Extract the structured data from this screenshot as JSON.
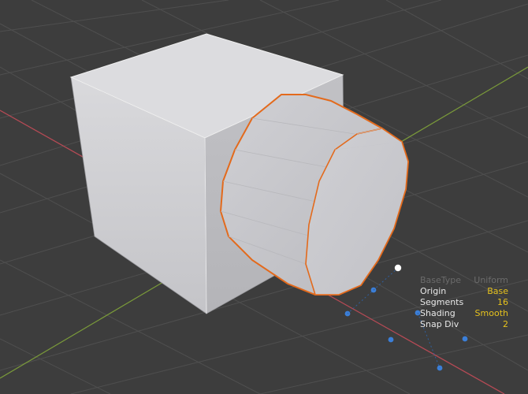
{
  "hud": {
    "rows": [
      {
        "label": "BaseType",
        "value": "Uniform",
        "dim": true
      },
      {
        "label": "Origin",
        "value": "Base"
      },
      {
        "label": "Segments",
        "value": "16"
      },
      {
        "label": "Shading",
        "value": "Smooth"
      },
      {
        "label": "Snap Div",
        "value": "2"
      }
    ]
  },
  "colors": {
    "background": "#3d3d3d",
    "grid": "#525252",
    "x_axis": "#b64a55",
    "y_axis": "#7a9a3a",
    "selection_outline": "#e36a1c",
    "snap_points": "#3b7fd9",
    "hud_value": "#e6c21d"
  },
  "objects": [
    "cube",
    "cylinder"
  ]
}
